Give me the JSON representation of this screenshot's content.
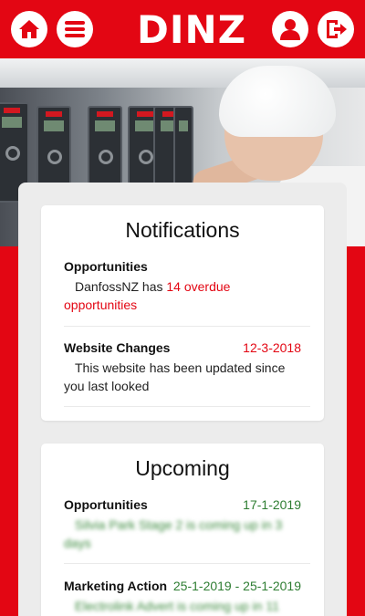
{
  "app": {
    "brand": "DINZ"
  },
  "topbar": {
    "left_icons": [
      "home-icon",
      "menu-icon"
    ],
    "right_icons": [
      "user-icon",
      "logout-icon"
    ]
  },
  "colors": {
    "brand_red": "#e30613",
    "date_red": "#e30613",
    "date_green": "#2e7d32",
    "background": "#ececec"
  },
  "notifications": {
    "title": "Notifications",
    "items": [
      {
        "title": "Opportunities",
        "date": "",
        "body_prefix": "DanfossNZ has ",
        "body_highlight": "14 overdue opportunities"
      },
      {
        "title": "Website Changes",
        "date": "12-3-2018",
        "body_prefix": "This website has been updated since you last looked",
        "body_highlight": ""
      }
    ]
  },
  "upcoming": {
    "title": "Upcoming",
    "items": [
      {
        "title": "Opportunities",
        "date": "17-1-2019",
        "body_link": "Silvia Park Stage 2",
        "body_rest": " is coming up in 3 days"
      },
      {
        "title": "Marketing Action",
        "date": "25-1-2019 - 25-1-2019",
        "body_link": "Electrolink Advert",
        "body_rest": " is coming up in 11"
      }
    ]
  }
}
